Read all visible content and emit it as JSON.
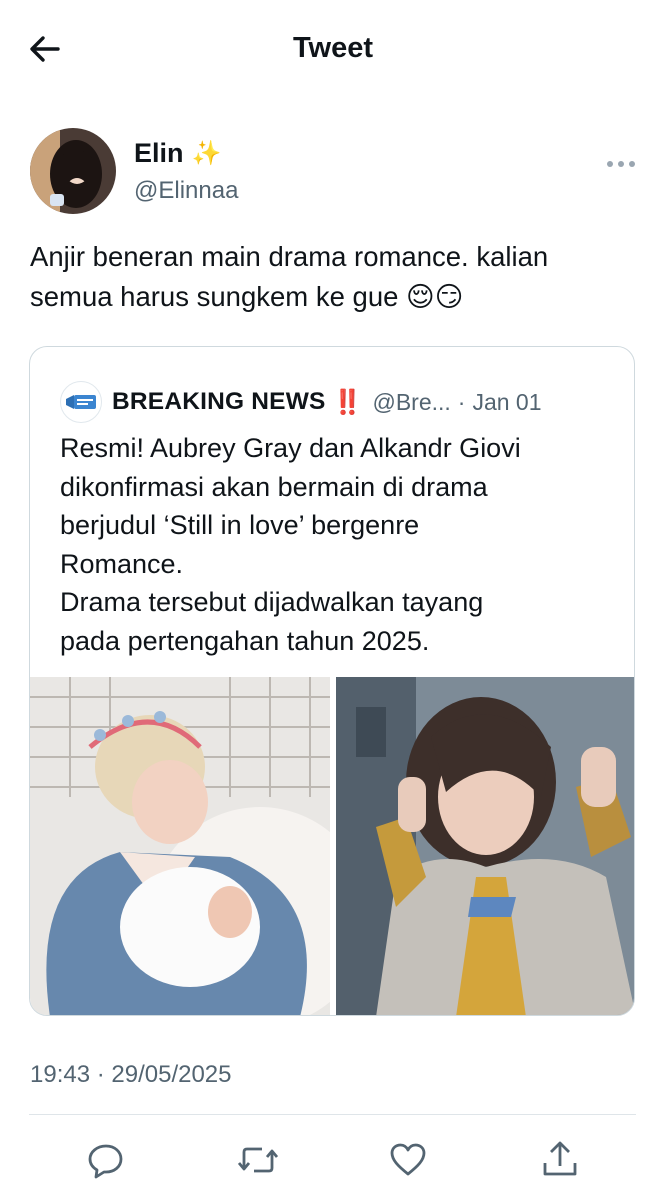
{
  "header": {
    "title": "Tweet",
    "back_icon": "arrow-left-icon"
  },
  "tweet": {
    "author_name": "Elin",
    "author_badge": "✨",
    "author_handle": "@Elinnaa",
    "more_icon": "more-horizontal-icon",
    "text_line1": "Anjir beneran main drama romance. kalian",
    "text_line2": "semua harus sungkem ke gue 😌😏",
    "timestamp": "19:43 · 29/05/2025"
  },
  "quote": {
    "name": "BREAKING NEWS",
    "badge": "‼️",
    "handle": "@Bre...",
    "date": "Jan 01",
    "lines": [
      "Resmi! Aubrey Gray dan Alkandr Giovi",
      "dikonfirmasi akan bermain di drama",
      "berjudul ‘Still in love’ bergenre",
      "Romance.",
      "Drama tersebut dijadwalkan tayang",
      "pada pertengahan tahun 2025."
    ]
  },
  "actions": {
    "reply_icon": "reply-icon",
    "retweet_icon": "retweet-icon",
    "like_icon": "like-heart-icon",
    "share_icon": "share-icon"
  },
  "colors": {
    "secondary_text": "#536471",
    "border": "#cfd9de",
    "alert": "#e0245e"
  }
}
